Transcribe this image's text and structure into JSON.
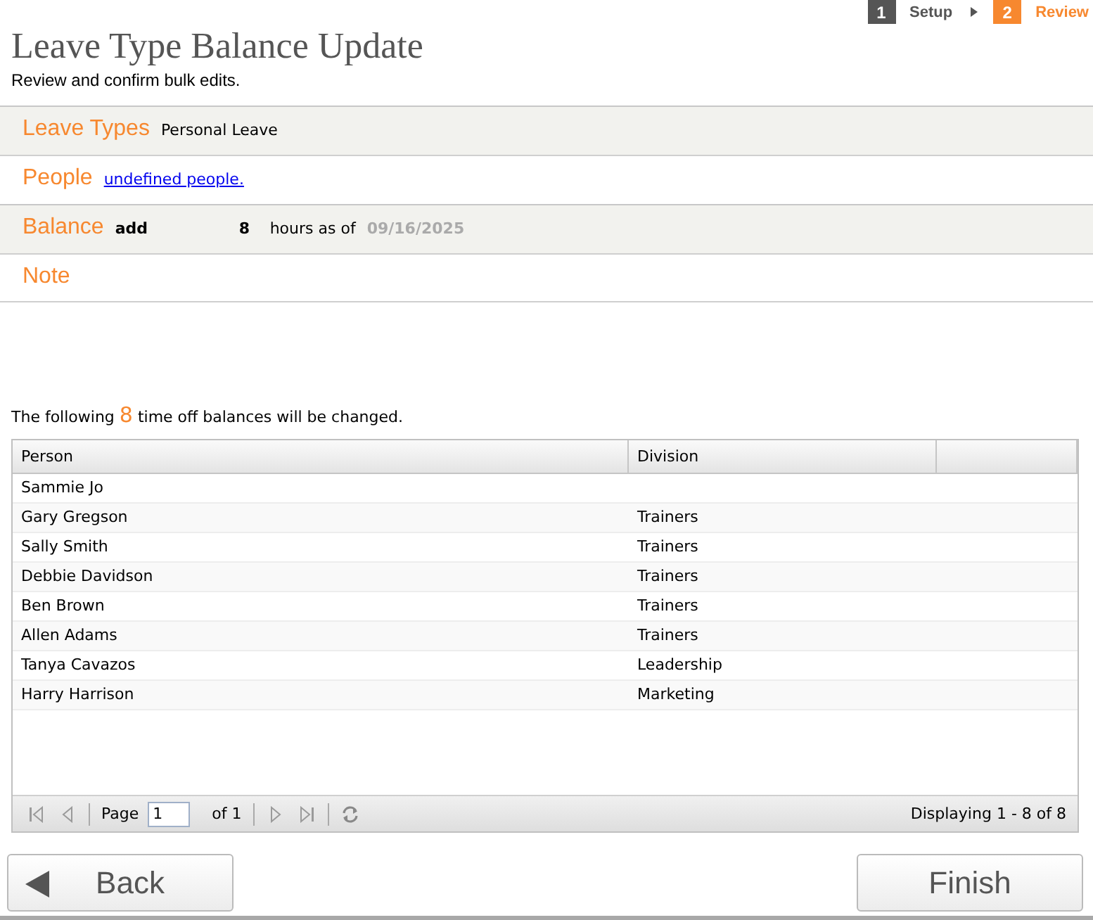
{
  "wizard": {
    "steps": [
      {
        "number": "1",
        "label": "Setup",
        "selected": false
      },
      {
        "number": "2",
        "label": "Review",
        "selected": true
      }
    ]
  },
  "header": {
    "title": "Leave Type Balance Update",
    "subtitle": "Review and confirm bulk edits."
  },
  "summary": [
    {
      "kind": "text",
      "label": "Leave Types",
      "value": "Personal Leave"
    },
    {
      "kind": "link",
      "label": "People",
      "link": "undefined people."
    },
    {
      "kind": "balance",
      "label": "Balance",
      "action": "add",
      "amount": "8",
      "unit": "hours as of",
      "date": "09/16/2025"
    },
    {
      "kind": "empty",
      "label": "Note"
    }
  ],
  "notice": "The following **8** time off balances will be changed.",
  "grid": {
    "columns": [
      "Person",
      "Division"
    ],
    "rows": [
      {
        "person": "Sammie Jo"
      },
      {
        "person": "Gary Gregson",
        "division": "Trainers"
      },
      {
        "person": "Sally Smith",
        "division": "Trainers"
      },
      {
        "person": "Debbie Davidson",
        "division": "Trainers"
      },
      {
        "person": "Ben Brown",
        "division": "Trainers"
      },
      {
        "person": "Allen Adams",
        "division": "Trainers"
      },
      {
        "person": "Tanya Cavazos",
        "division": "Leadership"
      },
      {
        "person": "Harry Harrison",
        "division": "Marketing"
      }
    ]
  },
  "pager": {
    "page_label": "Page",
    "page": "1",
    "of": "of 1",
    "display": "Displaying 1 - 8 of 8"
  },
  "buttons": [
    {
      "kind": "back",
      "label": "Back"
    },
    {
      "kind": "finish",
      "label": "Finish"
    }
  ]
}
